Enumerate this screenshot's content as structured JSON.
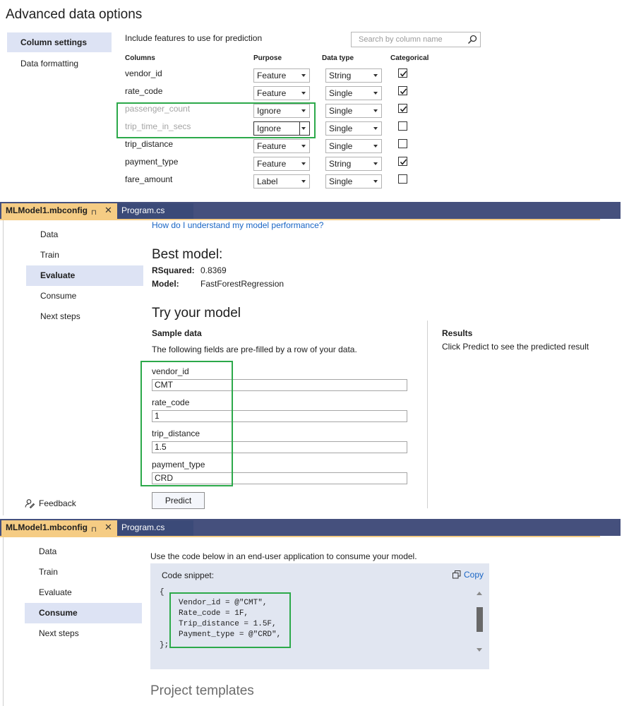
{
  "panel1": {
    "title": "Advanced data options",
    "sidebar": [
      {
        "label": "Column settings",
        "active": true
      },
      {
        "label": "Data formatting",
        "active": false
      }
    ],
    "include_label": "Include features to use for prediction",
    "search_placeholder": "Search by column name",
    "headers": {
      "columns": "Columns",
      "purpose": "Purpose",
      "data_type": "Data type",
      "categorical": "Categorical"
    },
    "rows": [
      {
        "name": "vendor_id",
        "purpose": "Feature",
        "type": "String",
        "categorical": true
      },
      {
        "name": "rate_code",
        "purpose": "Feature",
        "type": "Single",
        "categorical": true
      },
      {
        "name": "passenger_count",
        "purpose": "Ignore",
        "type": "Single",
        "categorical": true
      },
      {
        "name": "trip_time_in_secs",
        "purpose": "Ignore",
        "type": "Single",
        "categorical": false
      },
      {
        "name": "trip_distance",
        "purpose": "Feature",
        "type": "Single",
        "categorical": false
      },
      {
        "name": "payment_type",
        "purpose": "Feature",
        "type": "String",
        "categorical": true
      },
      {
        "name": "fare_amount",
        "purpose": "Label",
        "type": "Single",
        "categorical": false
      }
    ]
  },
  "panel2": {
    "tab_active": "MLModel1.mbconfig",
    "tab_pin": "⊓",
    "tab_close": "✕",
    "tab_other": "Program.cs",
    "nav": [
      {
        "label": "Data",
        "active": false
      },
      {
        "label": "Train",
        "active": false
      },
      {
        "label": "Evaluate",
        "active": true
      },
      {
        "label": "Consume",
        "active": false
      },
      {
        "label": "Next steps",
        "active": false
      }
    ],
    "help_link": "How do I understand my model performance?",
    "best_model_title": "Best model:",
    "rsquared_label": "RSquared:",
    "rsquared_value": "0.8369",
    "model_label": "Model:",
    "model_value": "FastForestRegression",
    "try_title": "Try your model",
    "sample_title": "Sample data",
    "sample_desc": "The following fields are pre-filled by a row of your data.",
    "fields": [
      {
        "label": "vendor_id",
        "value": "CMT"
      },
      {
        "label": "rate_code",
        "value": "1"
      },
      {
        "label": "trip_distance",
        "value": "1.5"
      },
      {
        "label": "payment_type",
        "value": "CRD"
      }
    ],
    "predict_button": "Predict",
    "results_title": "Results",
    "results_desc": "Click Predict to see the predicted result",
    "feedback": "Feedback"
  },
  "panel3": {
    "tab_active": "MLModel1.mbconfig",
    "tab_pin": "⊓",
    "tab_close": "✕",
    "tab_other": "Program.cs",
    "nav": [
      {
        "label": "Data",
        "active": false
      },
      {
        "label": "Train",
        "active": false
      },
      {
        "label": "Evaluate",
        "active": false
      },
      {
        "label": "Consume",
        "active": true
      },
      {
        "label": "Next steps",
        "active": false
      }
    ],
    "intro": "Use the code below in an end-user application to consume your model.",
    "code_title": "Code snippet:",
    "copy_label": "Copy",
    "code_open": "{",
    "code_lines": [
      "Vendor_id = @\"CMT\",",
      "Rate_code = 1F,",
      "Trip_distance = 1.5F,",
      "Payment_type = @\"CRD\","
    ],
    "code_close": "};",
    "project_templates": "Project templates"
  },
  "colors": {
    "highlight_box": "#2ca94a",
    "tab_active": "#f5cc84",
    "tab_strip": "#45507d",
    "nav_active": "#dde3f4",
    "link": "#1a66c5"
  }
}
